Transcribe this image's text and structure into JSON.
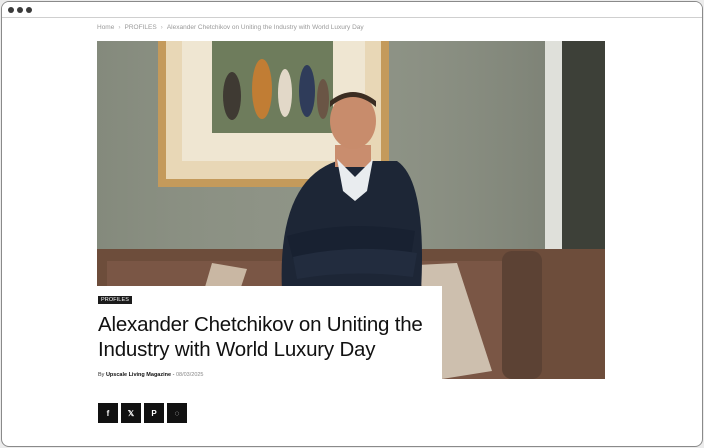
{
  "breadcrumb": {
    "home": "Home",
    "section": "PROFILES",
    "current": "Alexander Chetchikov on Uniting the Industry with World Luxury Day",
    "separator": "›"
  },
  "article": {
    "category": "PROFILES",
    "title": "Alexander Chetchikov on Uniting the Industry with World Luxury Day",
    "by_label": "By",
    "author": "Upscale Living Magazine",
    "date_separator": "-",
    "date": "08/03/2025"
  },
  "share": {
    "icons": [
      "facebook-icon",
      "x-icon",
      "pinterest-icon",
      "whatsapp-icon"
    ],
    "facebook_glyph": "f",
    "x_glyph": "𝕏",
    "pinterest_glyph": "P",
    "whatsapp_glyph": "◌"
  },
  "colors": {
    "badge_bg": "#1b1b1b",
    "share_bg": "#111111",
    "wall": "#8f9486",
    "frame_gold": "#c49a5b"
  }
}
